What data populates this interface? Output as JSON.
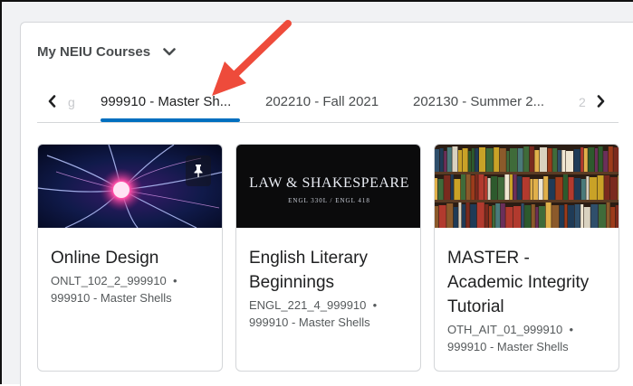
{
  "widget": {
    "title": "My NEIU Courses"
  },
  "tabs": {
    "fade_left": "g",
    "items": [
      {
        "label": "999910 - Master Sh..."
      },
      {
        "label": "202210 - Fall 2021"
      },
      {
        "label": "202130 - Summer 2..."
      }
    ],
    "fade_right": "2"
  },
  "courses": [
    {
      "title_lines": [
        "Online Design"
      ],
      "code": "ONLT_102_2_999910",
      "separator": "•",
      "semester": "999910 - Master Shells",
      "image": "plasma-ball",
      "pinned": true
    },
    {
      "title_lines": [
        "English Literary",
        "Beginnings"
      ],
      "code": "ENGL_221_4_999910",
      "separator": "•",
      "semester": "999910 - Master Shells",
      "image": "law-shakespeare-banner",
      "banner_title": "LAW & SHAKESPEARE",
      "banner_sub": "ENGL 330L  /  ENGL 418"
    },
    {
      "title_lines": [
        "MASTER -",
        "Academic Integrity",
        "Tutorial"
      ],
      "code": "OTH_AIT_01_999910",
      "separator": "•",
      "semester": "999910 - Master Shells",
      "image": "bookshelf"
    }
  ],
  "colors": {
    "accent": "#006fbf",
    "annotation": "#ee4b3b"
  }
}
